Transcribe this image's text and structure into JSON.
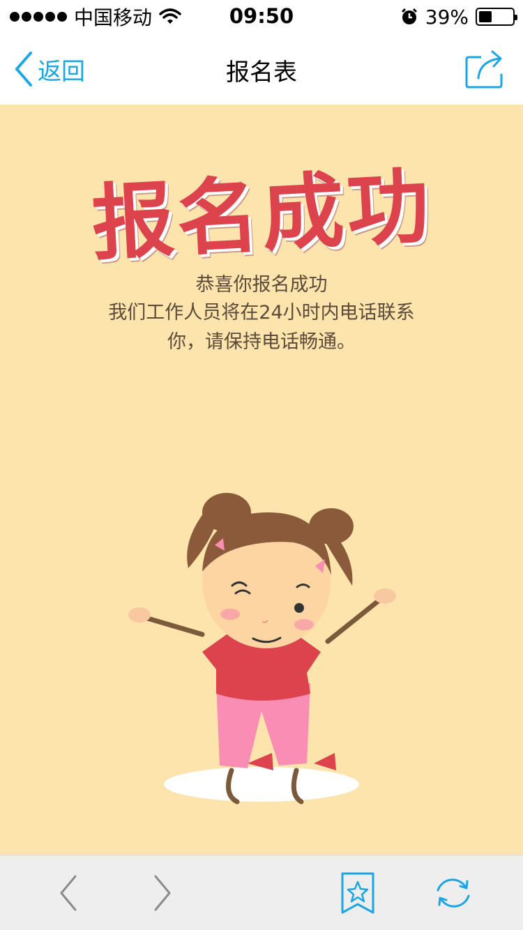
{
  "status_bar": {
    "carrier": "中国移动",
    "time": "09:50",
    "battery": "39%",
    "battery_level": 0.39
  },
  "nav": {
    "back_label": "返回",
    "title": "报名表"
  },
  "content": {
    "headline": "报名成功",
    "message_line1": "恭喜你报名成功",
    "message_line2": "我们工作人员将在24小时内电话联系",
    "message_line3": "你，请保持电话畅通。"
  },
  "colors": {
    "accent": "#1aa6e4",
    "background": "#fde3ac",
    "headline": "#dc434d"
  },
  "icons": {
    "back": "chevron-left-icon",
    "share": "share-icon",
    "prev": "chevron-left-icon",
    "next": "chevron-right-icon",
    "bookmark": "bookmark-star-icon",
    "refresh": "refresh-icon"
  }
}
